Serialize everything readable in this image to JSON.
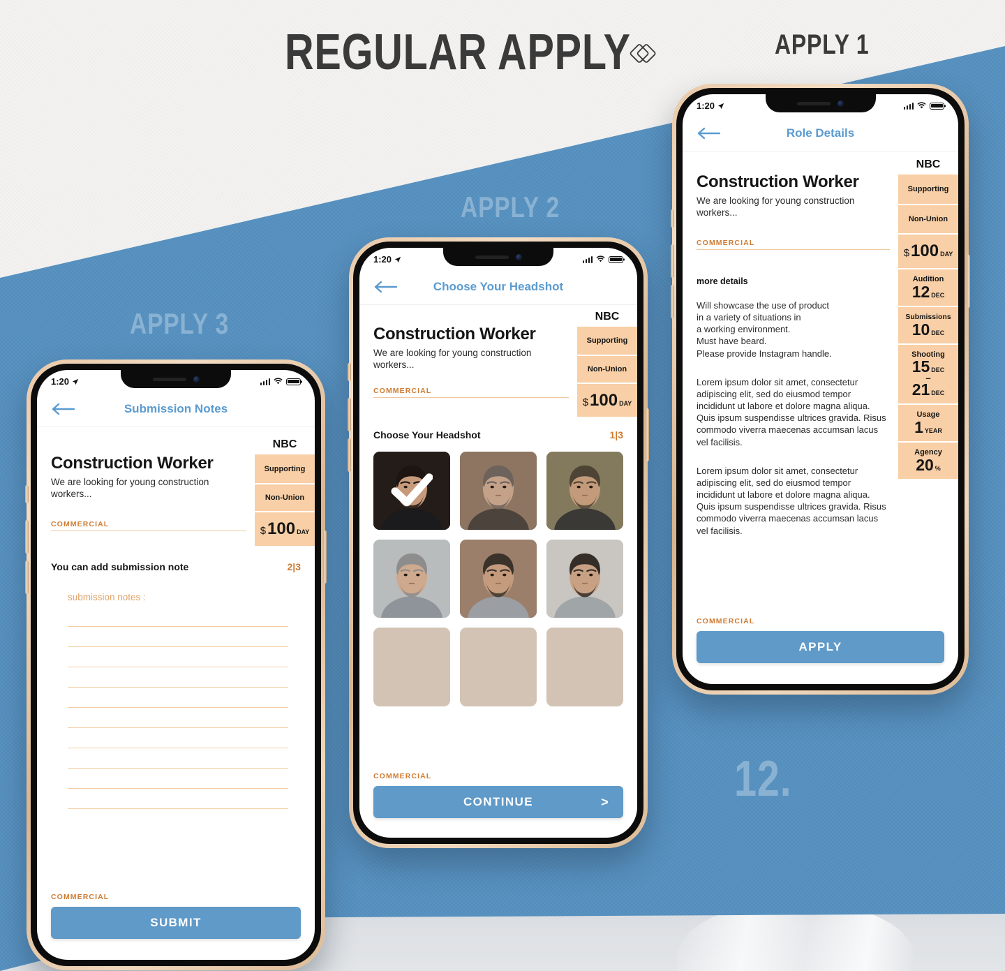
{
  "poster": {
    "title": "REGULAR APPLY",
    "logo_icon": "double-diamond-logo-icon",
    "label_apply1": "APPLY 1",
    "label_apply2": "APPLY 2",
    "label_apply3": "APPLY 3",
    "page_number": "12.",
    "colors": {
      "blue": "#5590c0",
      "button_blue": "#5f9ac9",
      "peach": "#f8cfa6",
      "orange_text": "#cf7b33",
      "nav_blue": "#5a9bd0",
      "paper": "#f4f3f1"
    }
  },
  "status_bar": {
    "time": "1:20",
    "location_icon": "location-arrow-icon",
    "signal_icon": "cellular-signal-icon",
    "wifi_icon": "wifi-icon",
    "battery_icon": "battery-full-icon"
  },
  "role": {
    "network": "NBC",
    "title": "Construction Worker",
    "subtitle": "We are looking for young construction workers...",
    "category": "COMMERCIAL",
    "chips": [
      {
        "label": "Supporting"
      },
      {
        "label": "Non-Union"
      },
      {
        "currency": "$",
        "value": "100",
        "unit": "DAY"
      }
    ]
  },
  "phone1": {
    "nav_title": "Role Details",
    "back_icon": "arrow-left-icon",
    "details_heading": "more details",
    "details_paragraphs": [
      "Will showcase the use of product\nin a variety of situations in\na working environment.\nMust have beard.\nPlease provide Instagram handle.",
      "Lorem ipsum dolor sit amet, consectetur adipiscing elit, sed do eiusmod tempor incididunt ut labore et dolore magna aliqua. Quis ipsum suspendisse ultrices gravida. Risus commodo viverra maecenas accumsan lacus vel facilisis.",
      "Lorem ipsum dolor sit amet, consectetur adipiscing elit, sed do eiusmod tempor incididunt ut labore et dolore magna aliqua. Quis ipsum suspendisse ultrices gravida. Risus commodo viverra maecenas accumsan lacus vel facilisis."
    ],
    "side_chips": [
      {
        "label": "Audition",
        "value": "12",
        "unit": "DEC"
      },
      {
        "label": "Submissions",
        "value": "10",
        "unit": "DEC"
      },
      {
        "label": "Shooting",
        "value": "15",
        "unit": "DEC",
        "value2": "21",
        "unit2": "DEC",
        "separator": "–"
      },
      {
        "label": "Usage",
        "value": "1",
        "unit": "YEAR"
      },
      {
        "label": "Agency",
        "value": "20",
        "unit": "%"
      }
    ],
    "bottom_category": "COMMERCIAL",
    "cta_label": "APPLY"
  },
  "phone2": {
    "nav_title": "Choose Your Headshot",
    "back_icon": "arrow-left-icon",
    "section_title": "Choose Your Headshot",
    "section_count": "1|3",
    "headshots": [
      {
        "id": 1,
        "selected": true,
        "empty": false,
        "check_icon": "checkmark-icon"
      },
      {
        "id": 2,
        "selected": false,
        "empty": false
      },
      {
        "id": 3,
        "selected": false,
        "empty": false
      },
      {
        "id": 4,
        "selected": false,
        "empty": false
      },
      {
        "id": 5,
        "selected": false,
        "empty": false
      },
      {
        "id": 6,
        "selected": false,
        "empty": false
      },
      {
        "id": 7,
        "selected": false,
        "empty": true
      },
      {
        "id": 8,
        "selected": false,
        "empty": true
      },
      {
        "id": 9,
        "selected": false,
        "empty": true
      }
    ],
    "bottom_category": "COMMERCIAL",
    "cta_label": "CONTINUE",
    "cta_chevron": ">"
  },
  "phone3": {
    "nav_title": "Submission Notes",
    "back_icon": "arrow-left-icon",
    "section_title": "You can add submission note",
    "section_count": "2|3",
    "notes_label": "submission notes :",
    "notes_line_count": 10,
    "notes_value": "",
    "notes_placeholder": "",
    "bottom_category": "COMMERCIAL",
    "cta_label": "SUBMIT"
  }
}
